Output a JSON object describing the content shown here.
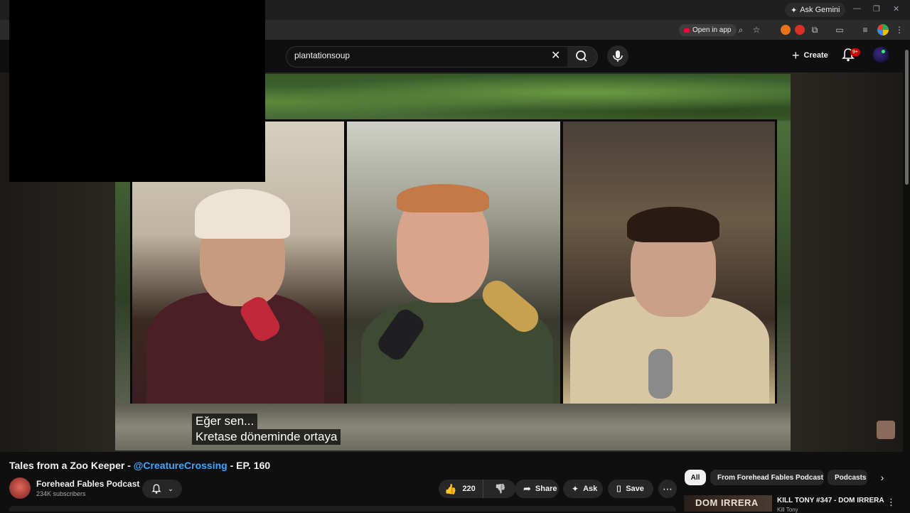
{
  "browser": {
    "gemini_label": "Ask Gemini",
    "open_in_app_label": "Open in app",
    "notification_badge": "9+"
  },
  "header": {
    "search_value": "plantationsoup",
    "create_label": "Create"
  },
  "player": {
    "caption_line_1": "Eğer sen...",
    "caption_line_2": "Kretase döneminde ortaya"
  },
  "video": {
    "title_prefix": "Tales from a Zoo Keeper - ",
    "title_mention": "@CreatureCrossing",
    "title_suffix": " - EP. 160",
    "channel_name": "Forehead Fables Podcast",
    "subscribers": "234K subscribers",
    "like_count": "220",
    "share_label": "Share",
    "ask_label": "Ask",
    "save_label": "Save"
  },
  "sidebar": {
    "chips": [
      "All",
      "From Forehead Fables Podcast",
      "Podcasts"
    ],
    "active_chip": "All",
    "recommended": {
      "thumb_text": "DOM IRRERA",
      "title": "KILL TONY #347 - DOM IRRERA",
      "channel": "Kill Tony"
    }
  },
  "colors": {
    "accent_mention": "#3ea6ff",
    "notification_red": "#cc0000",
    "background": "#0f0f0f"
  }
}
